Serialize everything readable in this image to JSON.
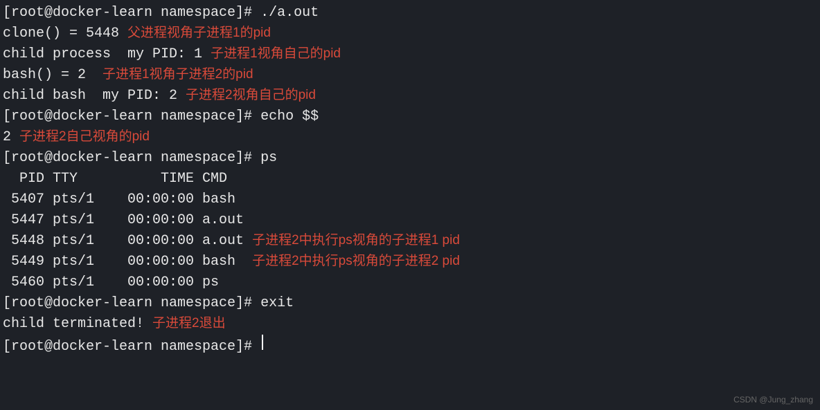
{
  "prompt": "[root@docker-learn namespace]# ",
  "lines": {
    "l1_cmd": "./a.out",
    "l2_out": "clone() = 5448 ",
    "l2_note": "父进程视角子进程1的pid",
    "l3_out": "child process  my PID: 1 ",
    "l3_note": "子进程1视角自己的pid",
    "l4_out": "bash() = 2  ",
    "l4_note": "子进程1视角子进程2的pid",
    "l5_out": "child bash  my PID: 2 ",
    "l5_note": "子进程2视角自己的pid",
    "l6_cmd": "echo $$",
    "l7_out": "2 ",
    "l7_note": "子进程2自己视角的pid",
    "l8_cmd": "ps",
    "ps_header": "  PID TTY          TIME CMD",
    "ps_row1": " 5407 pts/1    00:00:00 bash",
    "ps_row2": " 5447 pts/1    00:00:00 a.out",
    "ps_row3": " 5448 pts/1    00:00:00 a.out ",
    "ps_row3_note": "子进程2中执行ps视角的子进程1 pid",
    "ps_row4": " 5449 pts/1    00:00:00 bash  ",
    "ps_row4_note": "子进程2中执行ps视角的子进程2 pid",
    "ps_row5": " 5460 pts/1    00:00:00 ps",
    "l14_cmd": "exit",
    "l15_out": "child terminated! ",
    "l15_note": "子进程2退出",
    "l16_cmd": ""
  },
  "watermark": "CSDN @Jung_zhang"
}
